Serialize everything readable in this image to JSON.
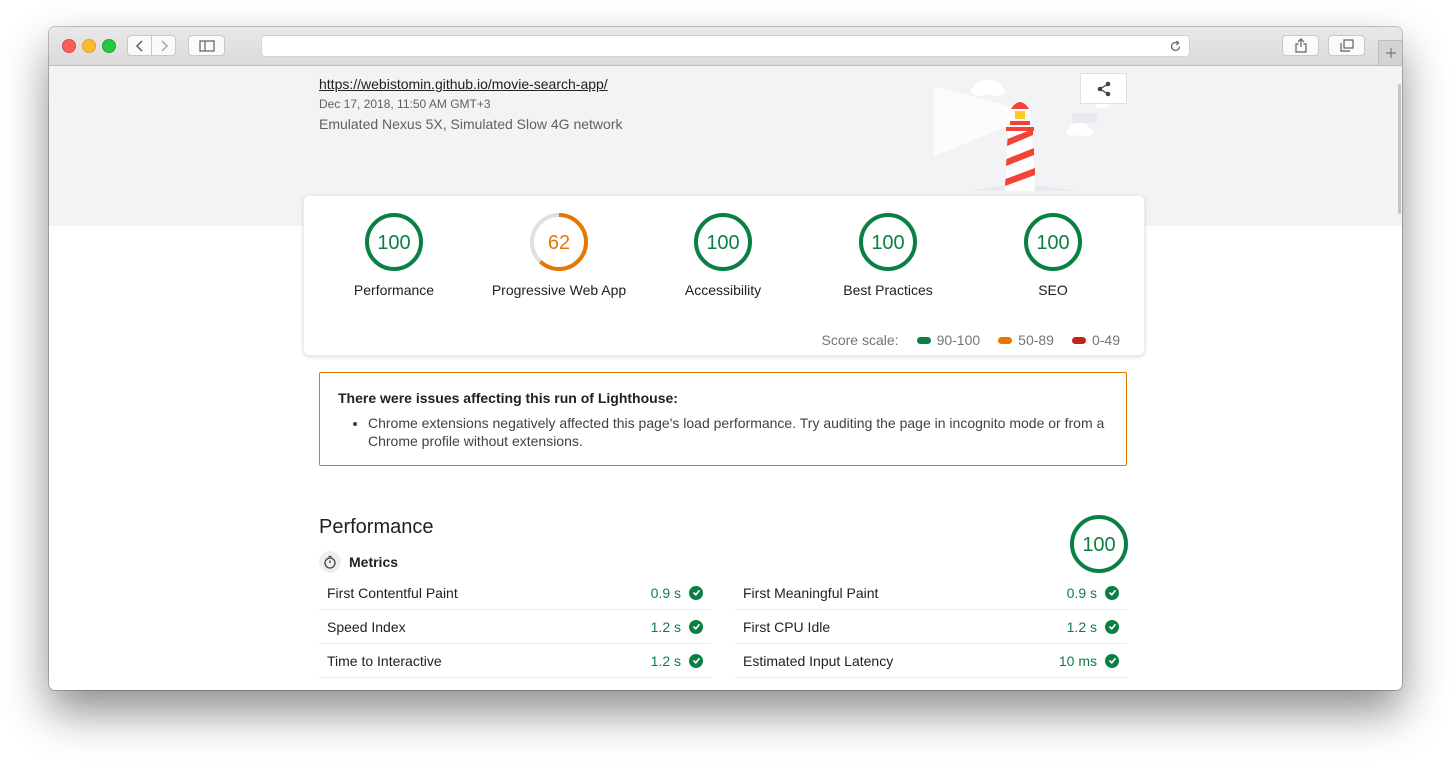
{
  "report": {
    "url": "https://webistomin.github.io/movie-search-app/",
    "date": "Dec 17, 2018, 11:50 AM GMT+3",
    "environment": "Emulated Nexus 5X, Simulated Slow 4G network"
  },
  "gauges": [
    {
      "label": "Performance",
      "score": "100",
      "fraction": 1.0,
      "color": "#0b8043"
    },
    {
      "label": "Progressive Web App",
      "score": "62",
      "fraction": 0.62,
      "color": "#e67700"
    },
    {
      "label": "Accessibility",
      "score": "100",
      "fraction": 1.0,
      "color": "#0b8043"
    },
    {
      "label": "Best Practices",
      "score": "100",
      "fraction": 1.0,
      "color": "#0b8043"
    },
    {
      "label": "SEO",
      "score": "100",
      "fraction": 1.0,
      "color": "#0b8043"
    }
  ],
  "score_scale": {
    "label": "Score scale:",
    "items": [
      {
        "range": "90-100",
        "color": "#0b8043"
      },
      {
        "range": "50-89",
        "color": "#e67700"
      },
      {
        "range": "0-49",
        "color": "#c7221f"
      }
    ]
  },
  "warning": {
    "title": "There were issues affecting this run of Lighthouse:",
    "items": [
      "Chrome extensions negatively affected this page's load performance. Try auditing the page in incognito mode or from a Chrome profile without extensions."
    ]
  },
  "performance": {
    "title": "Performance",
    "score": "100",
    "metrics_label": "Metrics",
    "metrics_left": [
      {
        "name": "First Contentful Paint",
        "value": "0.9 s"
      },
      {
        "name": "Speed Index",
        "value": "1.2 s"
      },
      {
        "name": "Time to Interactive",
        "value": "1.2 s"
      }
    ],
    "metrics_right": [
      {
        "name": "First Meaningful Paint",
        "value": "0.9 s"
      },
      {
        "name": "First CPU Idle",
        "value": "1.2 s"
      },
      {
        "name": "Estimated Input Latency",
        "value": "10 ms"
      }
    ]
  },
  "icons": [
    "back-icon",
    "forward-icon",
    "sidebar-icon",
    "reload-icon",
    "share-icon",
    "tabs-icon",
    "plus-icon",
    "share-report-icon",
    "stopwatch-icon",
    "check-icon",
    "lighthouse-illustration"
  ]
}
